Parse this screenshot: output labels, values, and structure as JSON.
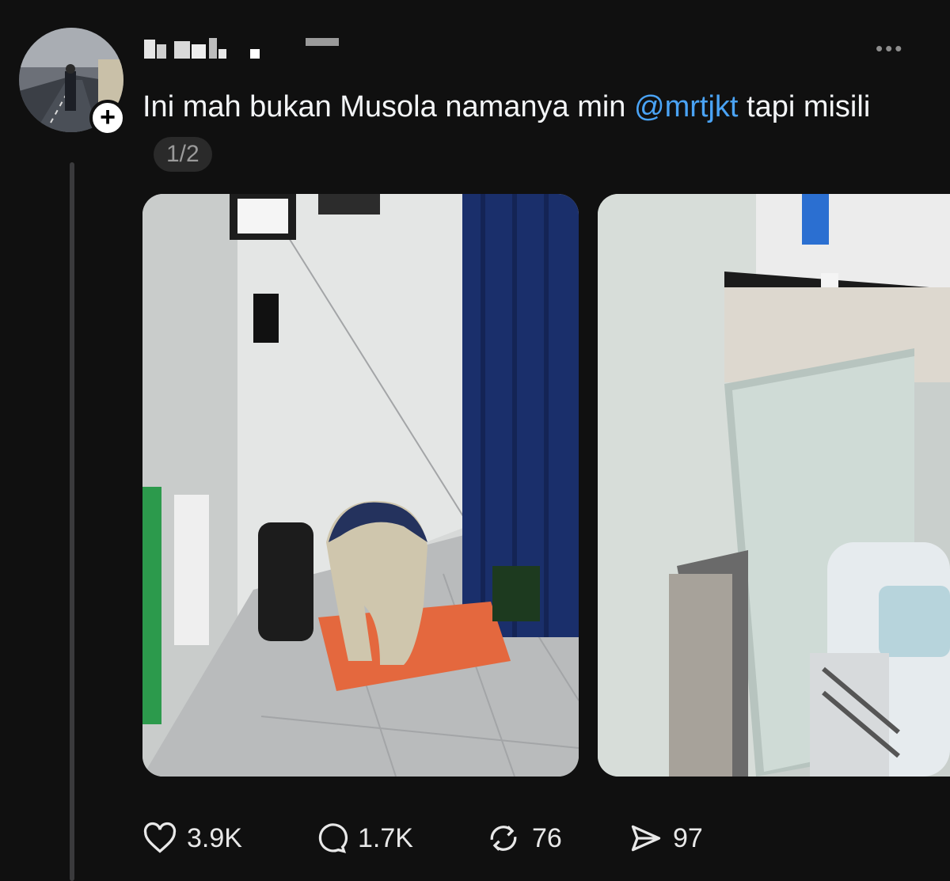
{
  "post": {
    "text_before": "Ini mah bukan Musola namanya min ",
    "mention": "@mrtjkt",
    "text_after": " tapi misili",
    "pager": "1/2"
  },
  "actions": {
    "likes": "3.9K",
    "replies": "1.7K",
    "reposts": "76",
    "shares": "97"
  },
  "icons": [
    "plus-icon",
    "more-icon",
    "heart-icon",
    "reply-icon",
    "repost-icon",
    "share-icon"
  ],
  "colors": {
    "background": "#101010",
    "mention": "#4aa3f5",
    "text": "#f3f5f7"
  }
}
